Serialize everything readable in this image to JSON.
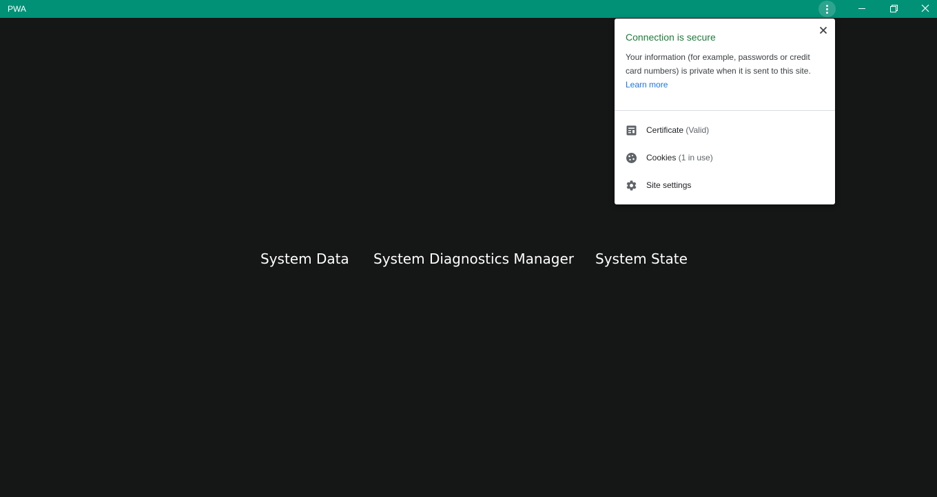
{
  "window": {
    "title": "PWA",
    "menu_icon": "more-vert-icon",
    "minimize_icon": "minimize-icon",
    "restore_icon": "restore-icon",
    "close_icon": "close-icon"
  },
  "nav": {
    "items": [
      {
        "label": "System Data"
      },
      {
        "label": "System Diagnostics Manager"
      },
      {
        "label": "System State"
      }
    ]
  },
  "site_info_popup": {
    "title": "Connection is secure",
    "description": "Your information (for example, passwords or credit card numbers) is private when it is sent to this site.",
    "learn_more": "Learn more",
    "items": [
      {
        "label": "Certificate",
        "detail": "(Valid)",
        "icon": "certificate-icon"
      },
      {
        "label": "Cookies",
        "detail": "(1 in use)",
        "icon": "cookie-icon"
      },
      {
        "label": "Site settings",
        "detail": "",
        "icon": "gear-icon"
      }
    ],
    "colors": {
      "title": "#1e7b3a",
      "link": "#1a73e8"
    }
  },
  "colors": {
    "titlebar": "#009177",
    "background": "#151616"
  }
}
